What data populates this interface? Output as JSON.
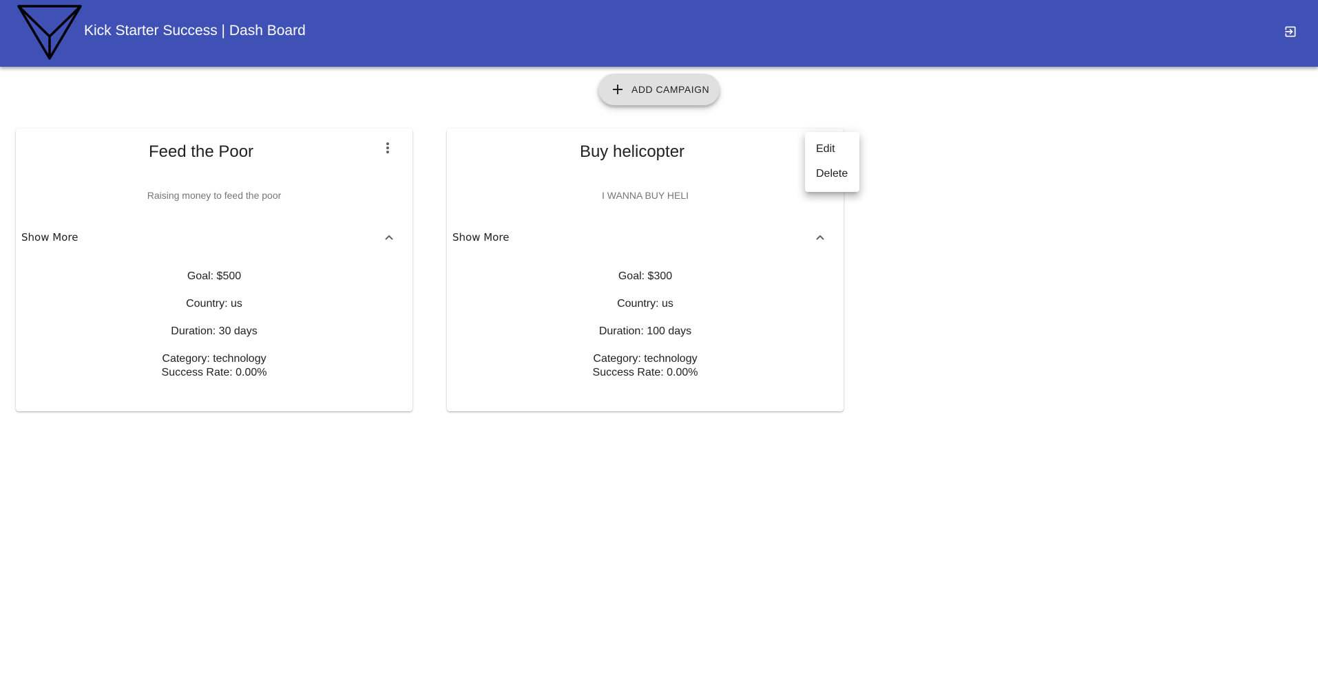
{
  "header": {
    "title": "Kick Starter Success | Dash Board",
    "logo_icon": "triangle-logo-icon",
    "logout_icon": "exit-to-app-icon",
    "background_color": "#3f51b5"
  },
  "add_campaign": {
    "label": "ADD CAMPAIGN",
    "icon": "plus-icon"
  },
  "campaigns": [
    {
      "title": "Feed the Poor",
      "description": "Raising money to feed the poor",
      "show_more_label": "Show More",
      "goal": "Goal: $500",
      "country": "Country: us",
      "duration": "Duration: 30 days",
      "category": "Category: technology",
      "success_rate": "Success Rate: 0.00%"
    },
    {
      "title": "Buy helicopter",
      "description": "I WANNA BUY HELI",
      "show_more_label": "Show More",
      "goal": "Goal: $300",
      "country": "Country: us",
      "duration": "Duration: 100 days",
      "category": "Category: technology",
      "success_rate": "Success Rate: 0.00%"
    }
  ],
  "context_menu": {
    "items": [
      "Edit",
      "Delete"
    ]
  }
}
